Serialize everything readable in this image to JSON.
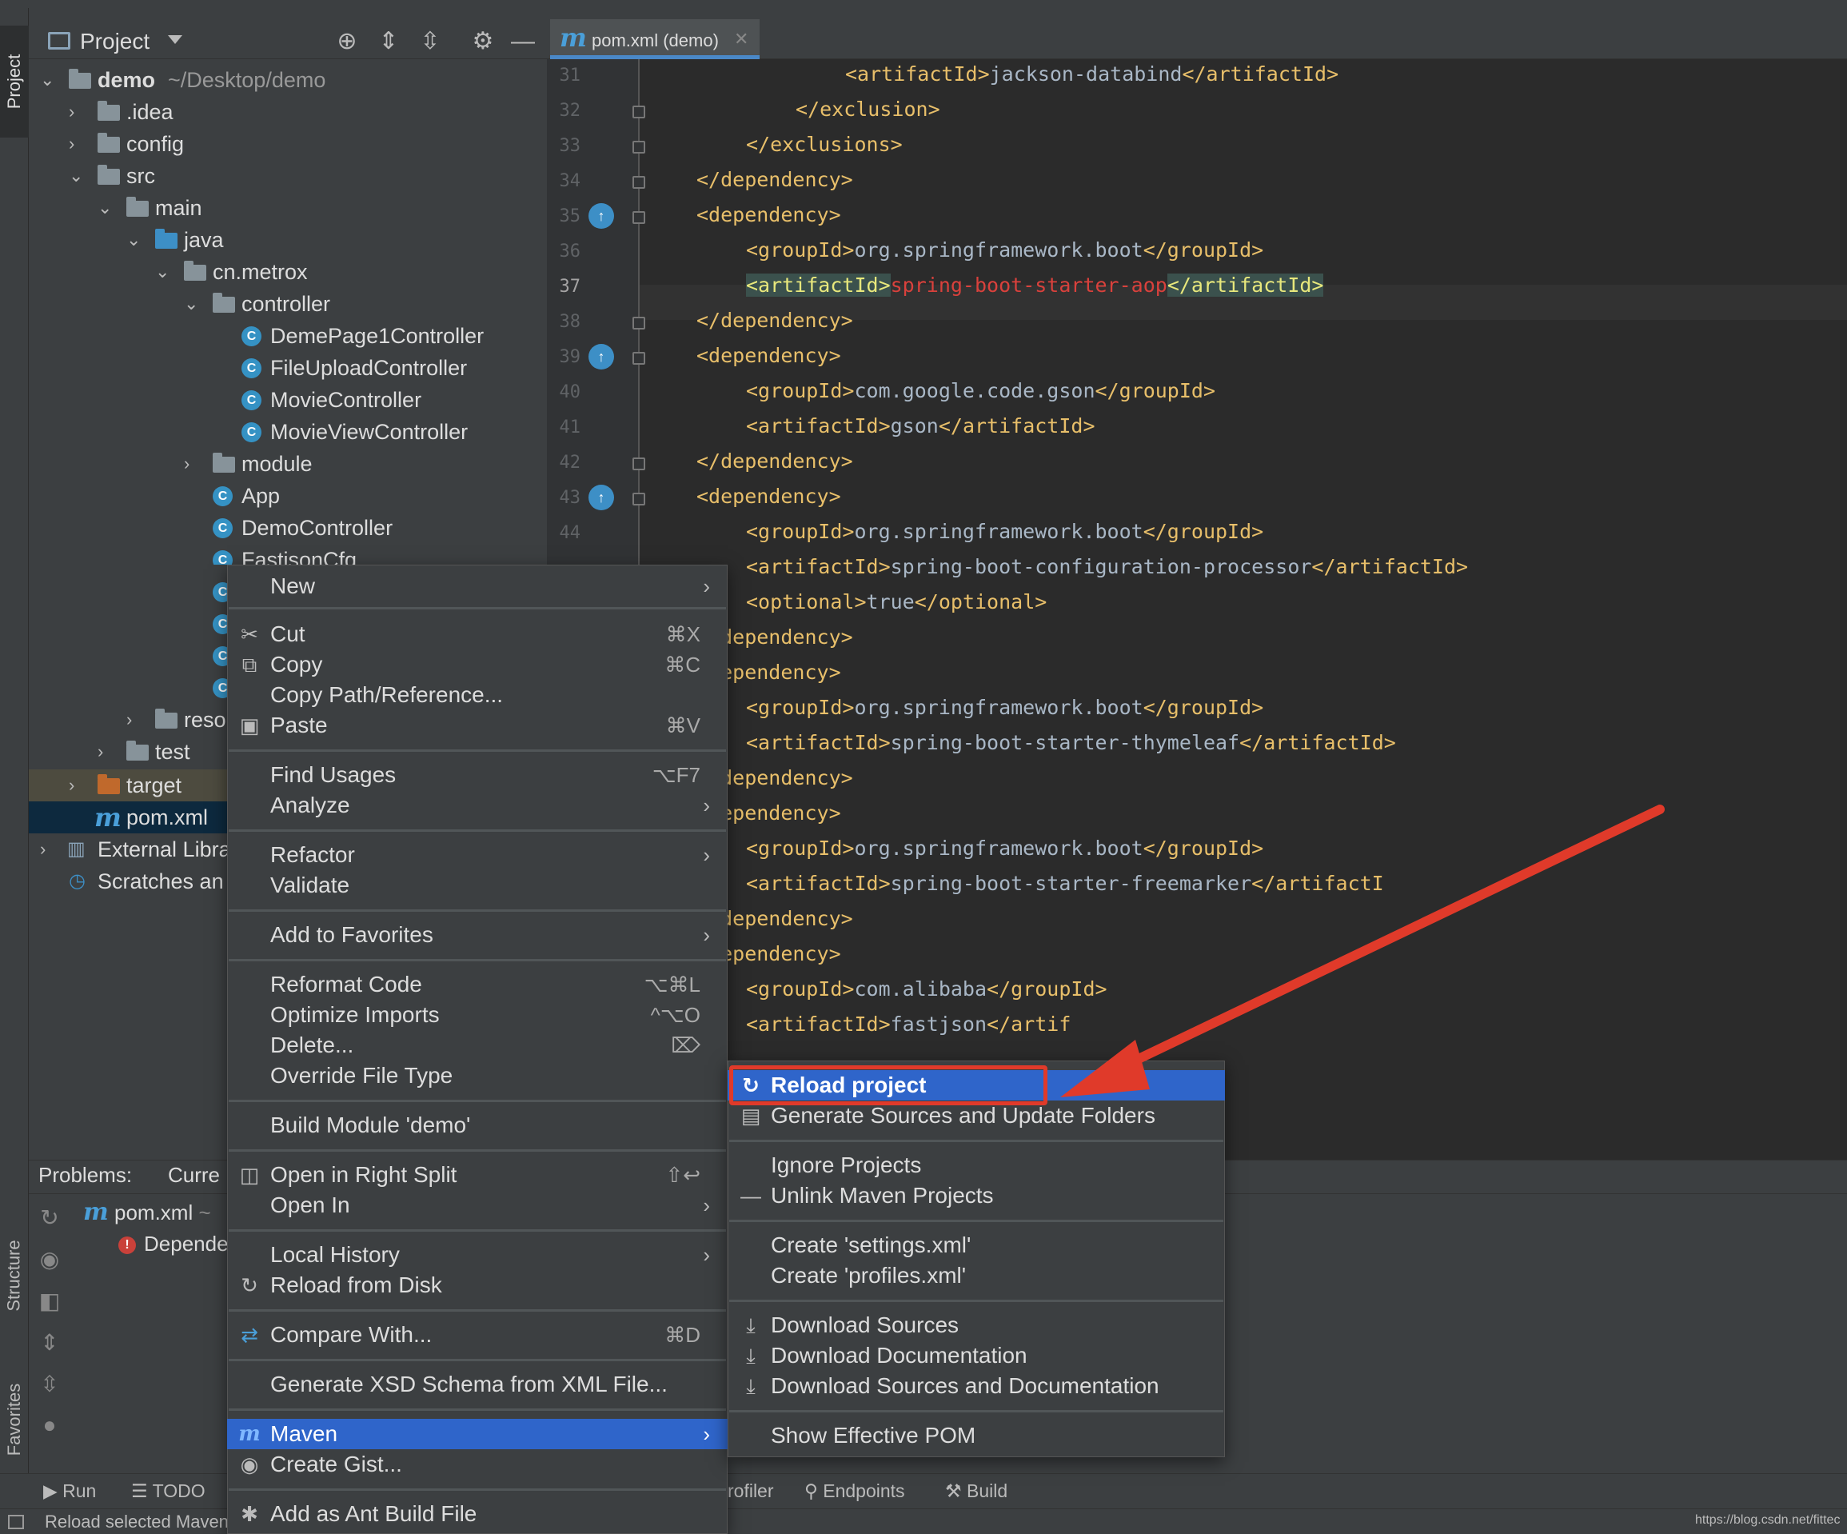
{
  "breadcrumb": {
    "root": "demo",
    "file": "pom.xml"
  },
  "left_strip": {
    "project": "Project",
    "structure": "Structure",
    "favorites": "Favorites"
  },
  "project_panel": {
    "title": "Project",
    "tree": [
      {
        "label": "demo",
        "suffix": "~/Desktop/demo"
      },
      {
        "label": ".idea"
      },
      {
        "label": "config"
      },
      {
        "label": "src"
      },
      {
        "label": "main"
      },
      {
        "label": "java"
      },
      {
        "label": "cn.metrox"
      },
      {
        "label": "controller"
      },
      {
        "label": "DemePage1Controller"
      },
      {
        "label": "FileUploadController"
      },
      {
        "label": "MovieController"
      },
      {
        "label": "MovieViewController"
      },
      {
        "label": "module"
      },
      {
        "label": "App"
      },
      {
        "label": "DemoController"
      },
      {
        "label": "FastjsonCfg"
      },
      {
        "label": "reso"
      },
      {
        "label": "test"
      },
      {
        "label": "target"
      },
      {
        "label": "pom.xml"
      },
      {
        "label": "External Libra"
      },
      {
        "label": "Scratches an"
      }
    ]
  },
  "editor": {
    "tab_label": "pom.xml (demo)",
    "current_line": "37",
    "lines": [
      {
        "n": "31",
        "open": "<artifactId>",
        "text": "jackson-databind",
        "close": "</artifactId>"
      },
      {
        "n": "32",
        "open": "</exclusion>"
      },
      {
        "n": "33",
        "open": "</exclusions>"
      },
      {
        "n": "34",
        "open": "</dependency>"
      },
      {
        "n": "35",
        "open": "<dependency>"
      },
      {
        "n": "36",
        "open": "<groupId>",
        "text": "org.springframework.boot",
        "close": "</groupId>"
      },
      {
        "n": "37",
        "open": "<artifactId>",
        "text": "spring-boot-starter-aop",
        "close": "</artifactId>"
      },
      {
        "n": "38",
        "open": "</dependency>"
      },
      {
        "n": "39",
        "open": "<dependency>"
      },
      {
        "n": "40",
        "open": "<groupId>",
        "text": "com.google.code.gson",
        "close": "</groupId>"
      },
      {
        "n": "41",
        "open": "<artifactId>",
        "text": "gson",
        "close": "</artifactId>"
      },
      {
        "n": "42",
        "open": "</dependency>"
      },
      {
        "n": "43",
        "open": "<dependency>"
      },
      {
        "n": "44",
        "open": "<groupId>",
        "text": "org.springframework.boot",
        "close": "</groupId>"
      },
      {
        "n": "",
        "open": "<artifactId>",
        "text": "spring-boot-configuration-processor",
        "close": "</artifactId>"
      },
      {
        "n": "",
        "open": "<optional>",
        "text": "true",
        "close": "</optional>"
      },
      {
        "n": "",
        "open": "</dependency>"
      },
      {
        "n": "",
        "open": "<dependency>"
      },
      {
        "n": "",
        "open": "<groupId>",
        "text": "org.springframework.boot",
        "close": "</groupId>"
      },
      {
        "n": "",
        "open": "<artifactId>",
        "text": "spring-boot-starter-thymeleaf",
        "close": "</artifactId>"
      },
      {
        "n": "",
        "open": "</dependency>"
      },
      {
        "n": "",
        "open": "<dependency>"
      },
      {
        "n": "",
        "open": "<groupId>",
        "text": "org.springframework.boot",
        "close": "</groupId>"
      },
      {
        "n": "",
        "open": "<artifactId>",
        "text": "spring-boot-starter-freemarker",
        "close": "</artifactI"
      },
      {
        "n": "",
        "open": "</dependency>"
      },
      {
        "n": "",
        "open": "<dependency>"
      },
      {
        "n": "",
        "open": "<groupId>",
        "text": "com.alibaba",
        "close": "</groupId>"
      },
      {
        "n": "",
        "open": "<artifactId>",
        "text": "fastjson",
        "close": "</artif"
      }
    ]
  },
  "problems": {
    "title": "Problems:",
    "tab2": "Curre",
    "row1": "pom.xml",
    "row1_suffix": "~",
    "row2": "Depende"
  },
  "context_menu": {
    "items": [
      {
        "label": "New",
        "shortcut": "",
        "submenu": true,
        "icon": ""
      },
      {
        "label": "Cut",
        "shortcut": "⌘X",
        "icon": "✂"
      },
      {
        "label": "Copy",
        "shortcut": "⌘C",
        "icon": "⧉"
      },
      {
        "label": "Copy Path/Reference...",
        "shortcut": ""
      },
      {
        "label": "Paste",
        "shortcut": "⌘V",
        "icon": "📋"
      },
      {
        "label": "Find Usages",
        "shortcut": "⌥F7"
      },
      {
        "label": "Analyze",
        "submenu": true
      },
      {
        "label": "Refactor",
        "submenu": true
      },
      {
        "label": "Validate"
      },
      {
        "label": "Add to Favorites",
        "submenu": true
      },
      {
        "label": "Reformat Code",
        "shortcut": "⌥⌘L"
      },
      {
        "label": "Optimize Imports",
        "shortcut": "^⌥O"
      },
      {
        "label": "Delete...",
        "shortcut": "⌦"
      },
      {
        "label": "Override File Type"
      },
      {
        "label": "Build Module 'demo'"
      },
      {
        "label": "Open in Right Split",
        "shortcut": "⇧↩"
      },
      {
        "label": "Open In",
        "submenu": true
      },
      {
        "label": "Local History",
        "submenu": true
      },
      {
        "label": "Reload from Disk"
      },
      {
        "label": "Compare With...",
        "shortcut": "⌘D"
      },
      {
        "label": "Generate XSD Schema from XML File..."
      },
      {
        "label": "Maven",
        "submenu": true,
        "selected": true
      },
      {
        "label": "Create Gist..."
      },
      {
        "label": "Add as Ant Build File"
      }
    ]
  },
  "maven_submenu": {
    "items": [
      {
        "label": "Reload project",
        "selected": true
      },
      {
        "label": "Generate Sources and Update Folders"
      },
      {
        "label": "Ignore Projects"
      },
      {
        "label": "Unlink Maven Projects"
      },
      {
        "label": "Create 'settings.xml'"
      },
      {
        "label": "Create 'profiles.xml'"
      },
      {
        "label": "Download Sources"
      },
      {
        "label": "Download Documentation"
      },
      {
        "label": "Download Sources and Documentation"
      },
      {
        "label": "Show Effective POM"
      }
    ]
  },
  "toolwindow_bar": {
    "run": "Run",
    "todo": "TODO",
    "profiler": "rofiler",
    "endpoints": "Endpoints",
    "build": "Build"
  },
  "status": {
    "text": "Reload selected Maven",
    "watermark": "https://blog.csdn.net/fittec"
  },
  "colors": {
    "accent": "#2f65ca",
    "annotation": "#e03a2a",
    "tag": "#e8bf6a",
    "error_text": "#d9413c"
  }
}
